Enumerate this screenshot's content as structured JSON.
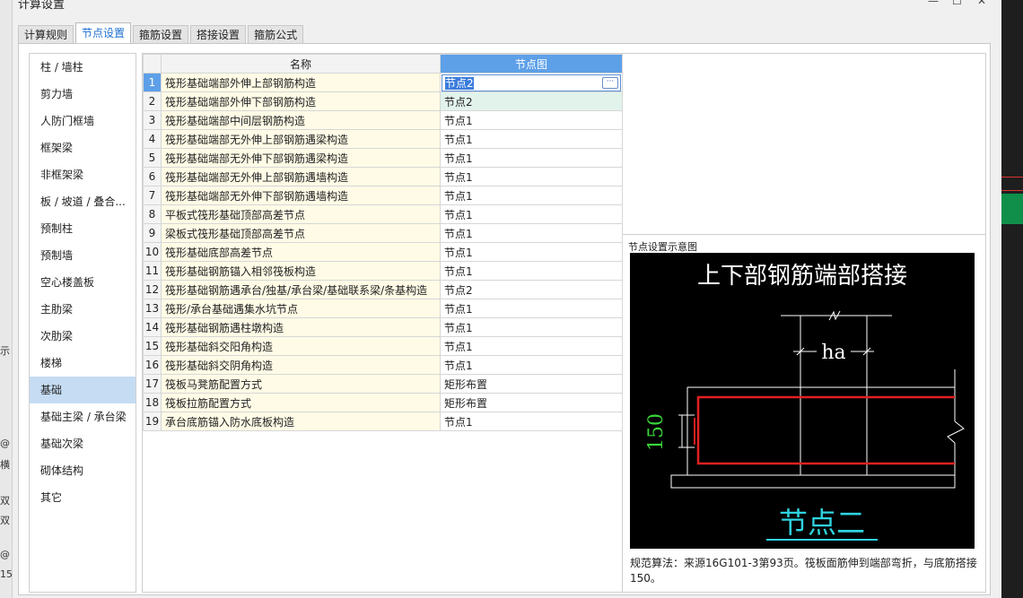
{
  "window": {
    "title": "计算设置",
    "minimize_glyph": "—",
    "maximize_glyph": "☐",
    "close_glyph": "✕"
  },
  "tabs": [
    {
      "label": "计算规则",
      "active": false
    },
    {
      "label": "节点设置",
      "active": true
    },
    {
      "label": "箍筋设置",
      "active": false
    },
    {
      "label": "搭接设置",
      "active": false
    },
    {
      "label": "箍筋公式",
      "active": false
    }
  ],
  "sidebar": {
    "items": [
      {
        "label": "柱 / 墙柱"
      },
      {
        "label": "剪力墙"
      },
      {
        "label": "人防门框墙"
      },
      {
        "label": "框架梁"
      },
      {
        "label": "非框架梁"
      },
      {
        "label": "板 / 坡道 / 叠合..."
      },
      {
        "label": "预制柱"
      },
      {
        "label": "预制墙"
      },
      {
        "label": "空心楼盖板"
      },
      {
        "label": "主肋梁"
      },
      {
        "label": "次肋梁"
      },
      {
        "label": "楼梯"
      },
      {
        "label": "基础",
        "active": true
      },
      {
        "label": "基础主梁 / 承台梁"
      },
      {
        "label": "基础次梁"
      },
      {
        "label": "砌体结构"
      },
      {
        "label": "其它"
      }
    ]
  },
  "grid": {
    "headers": {
      "name": "名称",
      "value": "节点图"
    },
    "rows": [
      {
        "num": "1",
        "name": "筏形基础端部外伸上部钢筋构造",
        "value": "节点2"
      },
      {
        "num": "2",
        "name": "筏形基础端部外伸下部钢筋构造",
        "value": "节点2"
      },
      {
        "num": "3",
        "name": "筏形基础端部中间层钢筋构造",
        "value": "节点1"
      },
      {
        "num": "4",
        "name": "筏形基础端部无外伸上部钢筋遇梁构造",
        "value": "节点1"
      },
      {
        "num": "5",
        "name": "筏形基础端部无外伸下部钢筋遇梁构造",
        "value": "节点1"
      },
      {
        "num": "6",
        "name": "筏形基础端部无外伸上部钢筋遇墙构造",
        "value": "节点1"
      },
      {
        "num": "7",
        "name": "筏形基础端部无外伸下部钢筋遇墙构造",
        "value": "节点1"
      },
      {
        "num": "8",
        "name": "平板式筏形基础顶部高差节点",
        "value": "节点1"
      },
      {
        "num": "9",
        "name": "梁板式筏形基础顶部高差节点",
        "value": "节点1"
      },
      {
        "num": "10",
        "name": "筏形基础底部高差节点",
        "value": "节点1"
      },
      {
        "num": "11",
        "name": "筏形基础钢筋锚入相邻筏板构造",
        "value": "节点1"
      },
      {
        "num": "12",
        "name": "筏形基础钢筋遇承台/独基/承台梁/基础联系梁/条基构造",
        "value": "节点2"
      },
      {
        "num": "13",
        "name": "筏形/承台基础遇集水坑节点",
        "value": "节点1"
      },
      {
        "num": "14",
        "name": "筏形基础钢筋遇柱墩构造",
        "value": "节点1"
      },
      {
        "num": "15",
        "name": "筏形基础斜交阳角构造",
        "value": "节点1"
      },
      {
        "num": "16",
        "name": "筏形基础斜交阴角构造",
        "value": "节点1"
      },
      {
        "num": "17",
        "name": "筏板马凳筋配置方式",
        "value": "矩形布置"
      },
      {
        "num": "18",
        "name": "筏板拉筋配置方式",
        "value": "矩形布置"
      },
      {
        "num": "19",
        "name": "承台底筋锚入防水底板构造",
        "value": "节点1"
      }
    ],
    "edit_button_glyph": "···"
  },
  "diagram": {
    "label": "节点设置示意图",
    "heading": "上下部钢筋端部搭接",
    "dim_ha": "ha",
    "dim_150": "150",
    "node_title": "节点二",
    "description": "规范算法：来源16G101-3第93页。筏板面筋伸到端部弯折，与底筋搭接150。"
  },
  "background": {
    "left_fragments": [
      "示",
      "@",
      "横",
      "双",
      "双",
      "@",
      "15"
    ]
  }
}
